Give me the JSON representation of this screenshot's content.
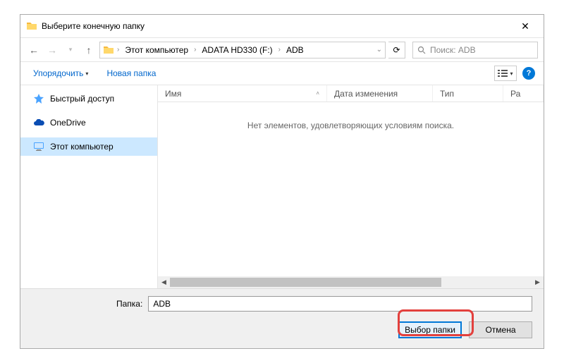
{
  "window": {
    "title": "Выберите конечную папку"
  },
  "breadcrumbs": {
    "root": "Этот компьютер",
    "drive": "ADATA HD330 (F:)",
    "folder": "ADB"
  },
  "search": {
    "placeholder": "Поиск: ADB"
  },
  "toolbar": {
    "organize": "Упорядочить",
    "new_folder": "Новая папка"
  },
  "sidebar": {
    "quick_access": "Быстрый доступ",
    "onedrive": "OneDrive",
    "this_pc": "Этот компьютер"
  },
  "columns": {
    "name": "Имя",
    "date": "Дата изменения",
    "type": "Тип",
    "size": "Ра"
  },
  "content": {
    "empty": "Нет элементов, удовлетворяющих условиям поиска."
  },
  "footer": {
    "folder_label": "Папка:",
    "folder_value": "ADB",
    "select": "Выбор папки",
    "cancel": "Отмена"
  }
}
